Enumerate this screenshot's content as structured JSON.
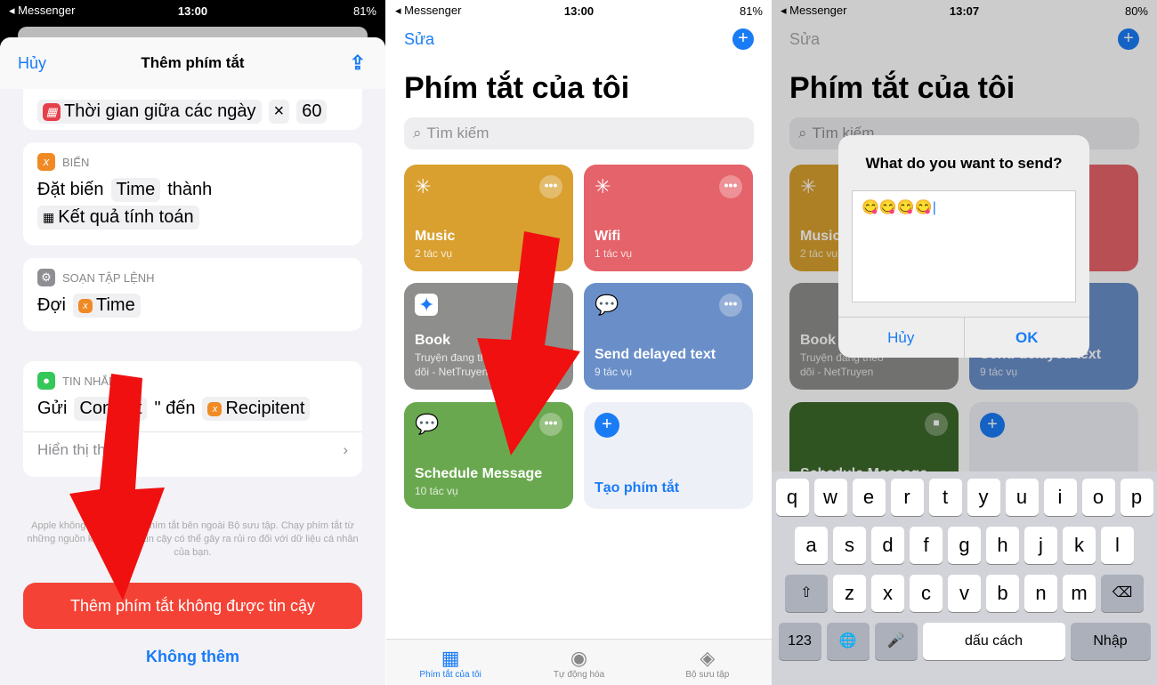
{
  "panels": [
    {
      "status": {
        "carrier": "◂ Messenger",
        "time": "13:00",
        "battery": "81%"
      },
      "header": {
        "cancel": "Hủy",
        "title": "Thêm phím tắt"
      },
      "card1": {
        "token": "Thời gian giữa các ngày",
        "op": "×",
        "value": "60"
      },
      "card2": {
        "category": "BIẾN",
        "verb": "Đặt biến",
        "var": "Time",
        "to": "thành",
        "result": "Kết quả tính toán"
      },
      "card3": {
        "category": "SOẠN TẬP LỆNH",
        "verb": "Đợi",
        "var": "Time"
      },
      "card4": {
        "category": "TIN NHẮN",
        "verb": "Gửi",
        "content": "Content",
        "quote": "\" đến",
        "recipient": "Recipitent",
        "more": "Hiển thị thêm"
      },
      "note": "Apple không kiểm tra các phím tắt bên ngoài Bộ sưu tập. Chạy phím tắt từ những nguồn không được tin cậy có thể gây ra rủi ro đối với dữ liệu cá nhân của bạn.",
      "primary": "Thêm phím tắt không được tin cậy",
      "secondary": "Không thêm"
    },
    {
      "status": {
        "carrier": "◂ Messenger",
        "time": "13:00",
        "battery": "81%"
      },
      "edit": "Sửa",
      "title": "Phím tắt của tôi",
      "search_placeholder": "Tìm kiếm",
      "tiles": [
        {
          "name": "Music",
          "sub": "2 tác vụ",
          "color": "#d9a030"
        },
        {
          "name": "Wifi",
          "sub": "1 tác vụ",
          "color": "#e5636a"
        },
        {
          "name": "Book",
          "sub": "Truyện đang theo dõi - NetTruyen",
          "color": "#8e8f8c"
        },
        {
          "name": "Send delayed text",
          "sub": "9 tác vụ",
          "color": "#6a8fc8"
        },
        {
          "name": "Schedule Message",
          "sub": "10 tác vụ",
          "color": "#6aa84f"
        },
        {
          "name": "Tạo phím tắt",
          "sub": "",
          "color": "#eef0f8"
        }
      ],
      "tabs": [
        "Phím tắt của tôi",
        "Tự động hóa",
        "Bộ sưu tập"
      ]
    },
    {
      "status": {
        "carrier": "◂ Messenger",
        "time": "13:07",
        "battery": "80%"
      },
      "alert": {
        "title": "What do you want to send?",
        "value": "😋😋😋😋",
        "cancel": "Hủy",
        "ok": "OK"
      },
      "keyboard": {
        "row1": [
          "q",
          "w",
          "e",
          "r",
          "t",
          "y",
          "u",
          "i",
          "o",
          "p"
        ],
        "row2": [
          "a",
          "s",
          "d",
          "f",
          "g",
          "h",
          "j",
          "k",
          "l"
        ],
        "row3": [
          "z",
          "x",
          "c",
          "v",
          "b",
          "n",
          "m"
        ],
        "num": "123",
        "space": "dấu cách",
        "enter": "Nhập"
      }
    }
  ]
}
